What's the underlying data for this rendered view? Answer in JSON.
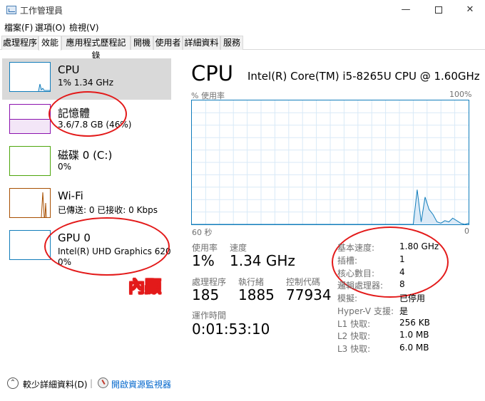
{
  "window": {
    "title": "工作管理員",
    "minimize_glyph": "—",
    "close_glyph": "✕"
  },
  "menu": [
    "檔案(F)",
    "選項(O)",
    "檢視(V)"
  ],
  "tabs": [
    "處理程序",
    "效能",
    "應用程式歷程記錄",
    "開機",
    "使用者",
    "詳細資料",
    "服務"
  ],
  "active_tab": "效能",
  "sidebar": {
    "items": [
      {
        "name": "CPU",
        "sub1": "1% 1.34 GHz",
        "sub2": "",
        "color": "#117dbb",
        "selected": true
      },
      {
        "name": "記憶體",
        "sub1": "3.6/7.8 GB (46%)",
        "sub2": "",
        "color": "#8b12ae",
        "selected": false
      },
      {
        "name": "磁碟 0 (C:)",
        "sub1": "0%",
        "sub2": "",
        "color": "#4da60c",
        "selected": false
      },
      {
        "name": "Wi-Fi",
        "sub1": "已傳送: 0 已接收: 0 Kbps",
        "sub2": "",
        "color": "#a74f01",
        "selected": false
      },
      {
        "name": "GPU 0",
        "sub1": "Intel(R) UHD Graphics 620",
        "sub2": "0%",
        "color": "#117dbb",
        "selected": false
      }
    ]
  },
  "annotation": {
    "gpu_label": "內顯",
    "color": "#e31a1a"
  },
  "main": {
    "title": "CPU",
    "model": "Intel(R) Core(TM) i5-8265U CPU @ 1.60GHz",
    "graph": {
      "top_left": "% 使用率",
      "top_right": "100%",
      "bottom_left": "60 秒",
      "bottom_right": "0",
      "line_color": "#117dbb",
      "usage_percent": [
        0,
        0,
        0,
        0,
        0,
        0,
        0,
        0,
        0,
        0,
        0,
        0,
        0,
        0,
        0,
        0,
        0,
        0,
        0,
        0,
        0,
        0,
        0,
        0,
        0,
        0,
        0,
        0,
        0,
        0,
        0,
        0,
        0,
        0,
        0,
        0,
        0,
        0,
        0,
        0,
        0,
        0,
        0,
        0,
        0,
        0,
        0,
        0,
        0,
        0,
        0,
        0,
        0,
        0,
        0,
        0,
        0,
        28,
        2,
        22,
        12,
        8,
        2,
        1,
        3,
        2,
        5,
        3,
        1,
        0,
        1
      ]
    },
    "stats": {
      "usage_label": "使用率",
      "usage_value": "1%",
      "speed_label": "速度",
      "speed_value": "1.34 GHz",
      "processes_label": "處理程序",
      "processes_value": "185",
      "threads_label": "執行緒",
      "threads_value": "1885",
      "handles_label": "控制代碼",
      "handles_value": "77934",
      "uptime_label": "運作時間",
      "uptime_value": "0:01:53:10"
    },
    "specs": [
      {
        "label": "基本速度:",
        "value": "1.80 GHz"
      },
      {
        "label": "插槽:",
        "value": "1"
      },
      {
        "label": "核心數目:",
        "value": "4"
      },
      {
        "label": "邏輯處理器:",
        "value": "8"
      },
      {
        "label": "模擬:",
        "value": "已停用"
      },
      {
        "label": "Hyper-V 支援:",
        "value": "是"
      },
      {
        "label": "L1 快取:",
        "value": "256 KB"
      },
      {
        "label": "L2 快取:",
        "value": "1.0 MB"
      },
      {
        "label": "L3 快取:",
        "value": "6.0 MB"
      }
    ]
  },
  "footer": {
    "collapse_glyph": "⌃",
    "collapse_label": "較少詳細資料(D)",
    "separator": "|",
    "monitor_link": "開啟資源監視器"
  }
}
